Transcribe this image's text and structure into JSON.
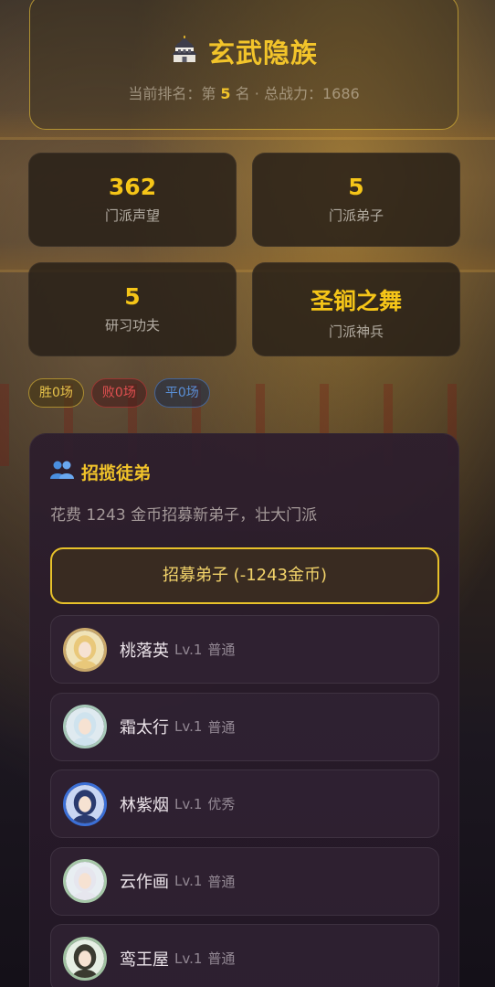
{
  "header": {
    "sect_name": "玄武隐族",
    "rank_prefix": "当前排名：第",
    "rank_value": "5",
    "rank_suffix": "名",
    "separator": "·",
    "power_label": "总战力：",
    "power_value": "1686"
  },
  "stats": [
    {
      "value": "362",
      "label": "门派声望"
    },
    {
      "value": "5",
      "label": "门派弟子"
    },
    {
      "value": "5",
      "label": "研习功夫"
    },
    {
      "value": "圣锏之舞",
      "label": "门派神兵"
    }
  ],
  "badges": {
    "win": "胜0场",
    "lose": "败0场",
    "draw": "平0场"
  },
  "recruit": {
    "title": "招揽徒弟",
    "description": "花费 1243 金币招募新弟子，壮大门派",
    "button_label": "招募弟子 (-1243金币)"
  },
  "disciples": [
    {
      "name": "桃落英",
      "level": "Lv.1",
      "grade": "普通",
      "ring": "#c9a86a",
      "hair": "#e9c87a",
      "bg": "#f0e3b8"
    },
    {
      "name": "霜太行",
      "level": "Lv.1",
      "grade": "普通",
      "ring": "#a6c8b8",
      "hair": "#cfe3ee",
      "bg": "#dfeaf0"
    },
    {
      "name": "林紫烟",
      "level": "Lv.1",
      "grade": "优秀",
      "ring": "#3b6fd6",
      "hair": "#2a3a6e",
      "bg": "#c9d6f2"
    },
    {
      "name": "云作画",
      "level": "Lv.1",
      "grade": "普通",
      "ring": "#a6c8a8",
      "hair": "#e6e6ee",
      "bg": "#e8eef2"
    },
    {
      "name": "鸾王屋",
      "level": "Lv.1",
      "grade": "普通",
      "ring": "#9fc0a0",
      "hair": "#3a3a30",
      "bg": "#e6efe4"
    }
  ]
}
